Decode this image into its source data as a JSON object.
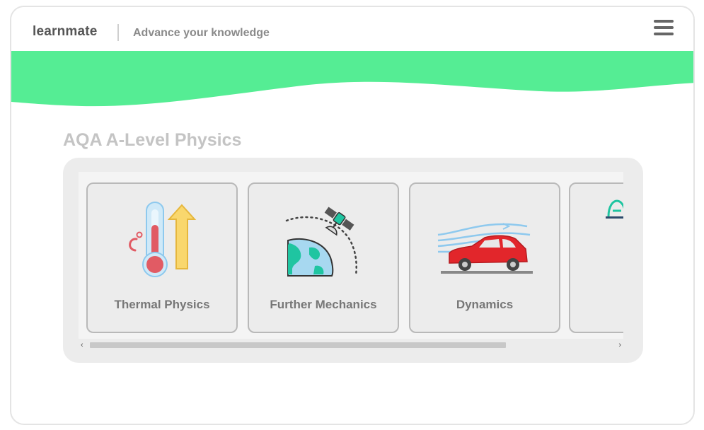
{
  "header": {
    "brand": "learnmate",
    "tagline": "Advance your knowledge",
    "menu_icon": "hamburger-menu-icon"
  },
  "colors": {
    "accent_wave": "#55ed94",
    "title_gray": "#c4c4c4"
  },
  "course": {
    "title": "AQA A-Level Physics"
  },
  "topics": [
    {
      "label": "Thermal Physics",
      "icon": "thermometer-icon"
    },
    {
      "label": "Further Mechanics",
      "icon": "satellite-orbit-icon"
    },
    {
      "label": "Dynamics",
      "icon": "car-airflow-icon"
    },
    {
      "label": "",
      "icon": "partial-topic-icon"
    }
  ],
  "scrollbar": {
    "left_arrow": "‹",
    "right_arrow": "›"
  }
}
